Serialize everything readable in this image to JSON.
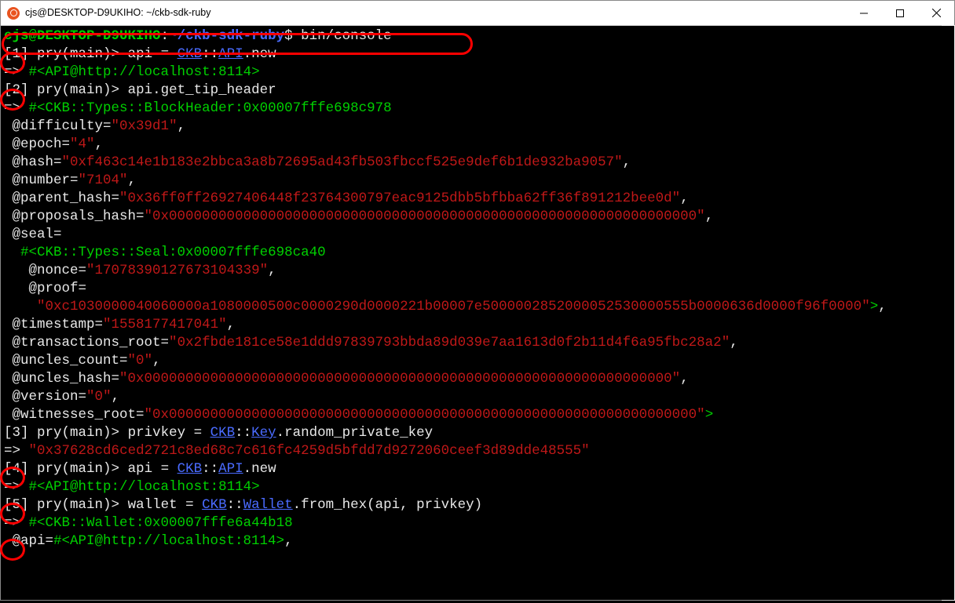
{
  "window": {
    "title": "cjs@DESKTOP-D9UKIHO: ~/ckb-sdk-ruby"
  },
  "shell": {
    "user_host": "cjs@DESKTOP-D9UKIHO",
    "path": "~/ckb-sdk-ruby",
    "prompt_sym": "$",
    "command": "bin/console"
  },
  "pry": {
    "lines": [
      {
        "n": "1",
        "input": "api = ",
        "const1": "CKB",
        "const2": "API",
        "tail": ".new"
      },
      {
        "n": "2",
        "input": "api.get_tip_header"
      },
      {
        "n": "3",
        "input": "privkey = ",
        "const1": "CKB",
        "const2": "Key",
        "tail": ".random_private_key"
      },
      {
        "n": "4",
        "input": "api = ",
        "const1": "CKB",
        "const2": "API",
        "tail": ".new"
      },
      {
        "n": "5",
        "input": "wallet = ",
        "const1": "CKB",
        "const2": "Wallet",
        "tail": ".from_hex(api, privkey)"
      }
    ],
    "arrow": "=>",
    "api_repr": "#<API@http://localhost:8114>",
    "header": {
      "klass": "#<CKB::Types::BlockHeader:0x00007fffe698c978",
      "difficulty": "0x39d1",
      "epoch": "4",
      "hash": "0xf463c14e1b183e2bbca3a8b72695ad43fb503fbccf525e9def6b1de932ba9057",
      "number": "7104",
      "parent_hash": "0x36ff0ff26927406448f23764300797eac9125dbb5bfbba62ff36f891212bee0d",
      "proposals_hash": "0x0000000000000000000000000000000000000000000000000000000000000000",
      "seal_klass": "#<CKB::Types::Seal:0x00007fffe698ca40",
      "nonce": "17078390127673104339",
      "proof": "0xc1030000040060000a1080000500c0000290d0000221b00007e5000002852000052530000555b0000636d0000f96f0000",
      "timestamp": "1558177417041",
      "transactions_root": "0x2fbde181ce58e1ddd97839793bbda89d039e7aa1613d0f2b11d4f6a95fbc28a2",
      "uncles_count": "0",
      "uncles_hash": "0x0000000000000000000000000000000000000000000000000000000000000000",
      "version": "0",
      "witnesses_root": "0x0000000000000000000000000000000000000000000000000000000000000000"
    },
    "privkey_value": "0x37628cd6ced2721c8ed68c7c616fc4259d5bfdd7d9272060ceef3d89dde48555",
    "wallet_repr": "#<CKB::Wallet:0x00007fffe6a44b18",
    "wallet_api": "#<API@http://localhost:8114>"
  }
}
